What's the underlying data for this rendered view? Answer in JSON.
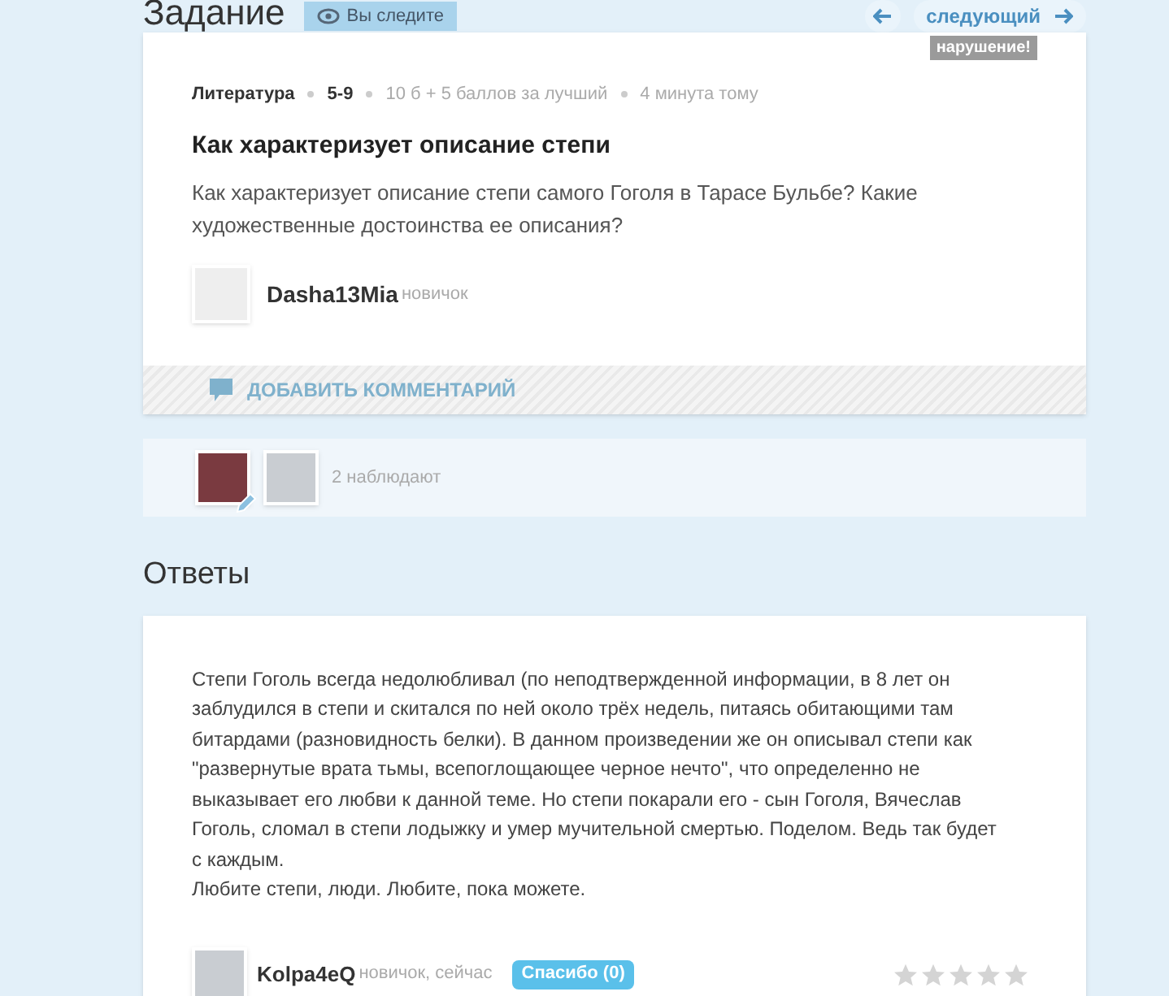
{
  "task": {
    "title": "Задание",
    "follow_button": "Вы следите",
    "next_button": "следующий",
    "report_label": "нарушение!",
    "subject": "Литература",
    "grade": "5-9",
    "points": "10 б + 5 баллов за лучший",
    "time": "4 минута тому",
    "question_title": "Как характеризует описание степи",
    "question_text": "Как характеризует описание степи самого Гоголя в Тарасе Бульбе? Какие художественные достоинства ее описания?",
    "author": {
      "name": "Dasha13Mia",
      "rank": "новичок"
    },
    "comment_button": "ДОБАВИТЬ КОММЕНТАРИЙ"
  },
  "watchers": {
    "count_label": "2 наблюдают"
  },
  "answers": {
    "title": "Ответы",
    "items": [
      {
        "text": "Степи Гоголь всегда недолюбливал (по неподтвержденной информации, в 8 лет он заблудился в степи и скитался по ней около трёх недель, питаясь обитающими там битардами (разновидность белки). В данном произведении же он описывал степи как \"развернутые врата тьмы, всепоглощающее черное нечто\", что определенно не выказывает его любви к данной теме. Но степи покарали его - сын Гоголя, Вячеслав Гоголь, сломал в степи лодыжку и умер мучительной смертью. Поделом. Ведь так будет с каждым.\nЛюбите степи, люди. Любите, пока можете.",
        "author": "Kolpa4eQ",
        "meta": "новичок, сейчас",
        "thanks_button": "Спасибо (0)",
        "stars": 0
      }
    ]
  }
}
